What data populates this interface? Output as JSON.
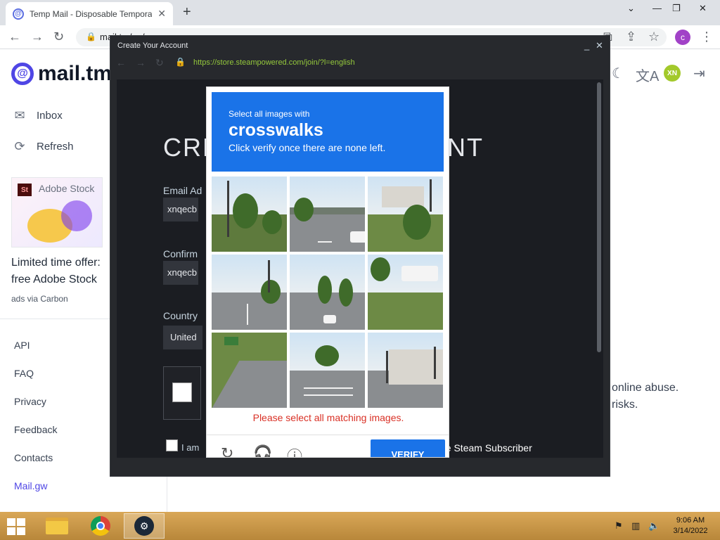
{
  "browser": {
    "tab_title": "Temp Mail - Disposable Tempora",
    "tab_close": "✕",
    "new_tab": "+",
    "address": "mail.tm/en/",
    "profile_initial": "c",
    "window_controls": {
      "dropdown": "⌄",
      "minimize": "—",
      "restore": "❐",
      "close": "✕"
    },
    "nav": {
      "back": "←",
      "forward": "→",
      "reload": "↻"
    },
    "toolbar_icons": {
      "cast": "⧉",
      "share": "⇪",
      "bookmark": "☆",
      "menu": "⋮"
    }
  },
  "mailtm": {
    "logo_text": "mail.tm",
    "nav": [
      {
        "label": "Inbox",
        "icon": "✉"
      },
      {
        "label": "Refresh",
        "icon": "⟳"
      }
    ],
    "ad": {
      "brand_badge": "St",
      "brand_name": "Adobe Stock",
      "text_line1": "Limited time offer:",
      "text_line2": "free Adobe Stock",
      "byline": "ads via Carbon"
    },
    "links": [
      "API",
      "FAQ",
      "Privacy",
      "Feedback",
      "Contacts",
      "Mail.gw"
    ],
    "header_icons": {
      "dark_mode": "☾",
      "translate": "文A",
      "logout": "⇥"
    },
    "avatar_initials": "XN",
    "body_text": [
      "online abuse.",
      "risks."
    ]
  },
  "steam": {
    "window_title": "Create Your Account",
    "window_controls": {
      "minimize": "_",
      "close": "✕"
    },
    "nav": {
      "back": "←",
      "forward": "→",
      "reload": "↻",
      "lock": "🔒"
    },
    "url": "https://store.steampowered.com/join/?l=english",
    "heading_left": "CRE",
    "heading_right": "NT",
    "email_label": "Email Ad",
    "email_value": "xnqecb",
    "confirm_label": "Confirm",
    "confirm_value": "xnqecb",
    "country_label": "Country",
    "country_value": "United",
    "agree_text": "I am",
    "subscriber_text": "he Steam Subscriber"
  },
  "captcha": {
    "prompt_line1": "Select all images with",
    "prompt_target": "crosswalks",
    "prompt_line3": "Click verify once there are none left.",
    "error": "Please select all matching images.",
    "reload_icon": "↻",
    "audio_icon": "🎧",
    "info_icon": "ⓘ",
    "verify_label": "VERIFY"
  },
  "taskbar": {
    "tray_icons": [
      "flag-icon",
      "network-icon",
      "volume-icon"
    ],
    "time": "9:06 AM",
    "date": "3/14/2022"
  }
}
